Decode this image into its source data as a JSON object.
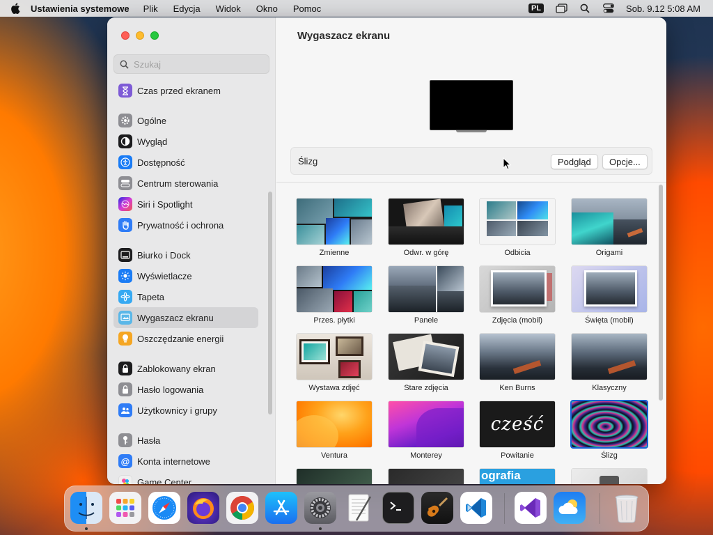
{
  "menubar": {
    "app_name": "Ustawienia systemowe",
    "menus": [
      "Plik",
      "Edycja",
      "Widok",
      "Okno",
      "Pomoc"
    ],
    "input_source": "PL",
    "clock": "Sob. 9.12  5:08 AM"
  },
  "sidebar": {
    "search_placeholder": "Szukaj",
    "items": [
      {
        "label": "Czas przed ekranem",
        "icon": "hourglass-icon",
        "color": "#7e5bd6"
      },
      {
        "label": "Ogólne",
        "icon": "gear-icon",
        "color": "#8e8e93"
      },
      {
        "label": "Wygląd",
        "icon": "appearance-icon",
        "color": "#1c1c1e"
      },
      {
        "label": "Dostępność",
        "icon": "accessibility-icon",
        "color": "#1a7cf5"
      },
      {
        "label": "Centrum sterowania",
        "icon": "toggles-icon",
        "color": "#8e8e93"
      },
      {
        "label": "Siri i Spotlight",
        "icon": "siri-icon",
        "color": "#b23bd6"
      },
      {
        "label": "Prywatność i ochrona",
        "icon": "hand-icon",
        "color": "#2f7cf6"
      },
      {
        "label": "Biurko i Dock",
        "icon": "dock-icon",
        "color": "#1c1c1e"
      },
      {
        "label": "Wyświetlacze",
        "icon": "sun-icon",
        "color": "#1a7cf5"
      },
      {
        "label": "Tapeta",
        "icon": "flower-icon",
        "color": "#36a9f2"
      },
      {
        "label": "Wygaszacz ekranu",
        "icon": "screensaver-icon",
        "color": "#5ab7e8"
      },
      {
        "label": "Oszczędzanie energii",
        "icon": "bulb-icon",
        "color": "#f5a623"
      },
      {
        "label": "Zablokowany ekran",
        "icon": "lock-icon",
        "color": "#1c1c1e"
      },
      {
        "label": "Hasło logowania",
        "icon": "padlock-icon",
        "color": "#8e8e93"
      },
      {
        "label": "Użytkownicy i grupy",
        "icon": "users-icon",
        "color": "#2f7cf6"
      },
      {
        "label": "Hasła",
        "icon": "key-icon",
        "color": "#8e8e93"
      },
      {
        "label": "Konta internetowe",
        "icon": "at-icon",
        "color": "#2f7cf6"
      },
      {
        "label": "Game Center",
        "icon": "game-center-icon",
        "color": "#e8e8e8"
      }
    ],
    "selected": "Wygaszacz ekranu"
  },
  "main": {
    "title": "Wygaszacz ekranu",
    "current_saver": "Ślizg",
    "preview_button": "Podgląd",
    "options_button": "Opcje...",
    "savers": [
      {
        "label": "Zmienne",
        "style": "mosaic"
      },
      {
        "label": "Odwr. w górę",
        "style": "flip"
      },
      {
        "label": "Odbicia",
        "style": "reflect"
      },
      {
        "label": "Origami",
        "style": "origami"
      },
      {
        "label": "Przes. płytki",
        "style": "tiles"
      },
      {
        "label": "Panele",
        "style": "panels"
      },
      {
        "label": "Zdjęcia (mobil)",
        "style": "mobile"
      },
      {
        "label": "Święta (mobil)",
        "style": "holiday"
      },
      {
        "label": "Wystawa zdjęć",
        "style": "wall"
      },
      {
        "label": "Stare zdjęcia",
        "style": "vintage"
      },
      {
        "label": "Ken Burns",
        "style": "mountains"
      },
      {
        "label": "Klasyczny",
        "style": "mountains2"
      },
      {
        "label": "Ventura",
        "style": "ventura"
      },
      {
        "label": "Monterey",
        "style": "monterey"
      },
      {
        "label": "Powitanie",
        "style": "hello",
        "text": "cześć"
      },
      {
        "label": "Ślizg",
        "style": "drift",
        "selected": true
      },
      {
        "label": "",
        "style": "partial-green"
      },
      {
        "label": "",
        "style": "partial-dark"
      },
      {
        "label": "",
        "style": "partial-word",
        "text": "ografia"
      },
      {
        "label": "",
        "style": "partial-light"
      }
    ]
  },
  "dock": {
    "apps": [
      {
        "name": "Finder",
        "icon": "finder-icon",
        "running": true
      },
      {
        "name": "Launchpad",
        "icon": "launchpad-icon",
        "running": false
      },
      {
        "name": "Safari",
        "icon": "safari-icon",
        "running": false
      },
      {
        "name": "Firefox",
        "icon": "firefox-icon",
        "running": false
      },
      {
        "name": "Chrome",
        "icon": "chrome-icon",
        "running": false
      },
      {
        "name": "App Store",
        "icon": "app-store-icon",
        "running": false
      },
      {
        "name": "Ustawienia systemowe",
        "icon": "system-settings-icon",
        "running": true
      },
      {
        "name": "TextEdit",
        "icon": "textedit-icon",
        "running": false
      },
      {
        "name": "Terminal",
        "icon": "terminal-icon",
        "running": false
      },
      {
        "name": "GarageBand",
        "icon": "guitar-icon",
        "running": false
      },
      {
        "name": "Visual Studio Code",
        "icon": "vscode-icon",
        "running": false
      },
      {
        "name": "Visual Studio",
        "icon": "visual-studio-icon",
        "running": false
      },
      {
        "name": "Weather",
        "icon": "weather-icon",
        "running": false
      },
      {
        "name": "Trash",
        "icon": "trash-icon",
        "running": false
      }
    ]
  }
}
